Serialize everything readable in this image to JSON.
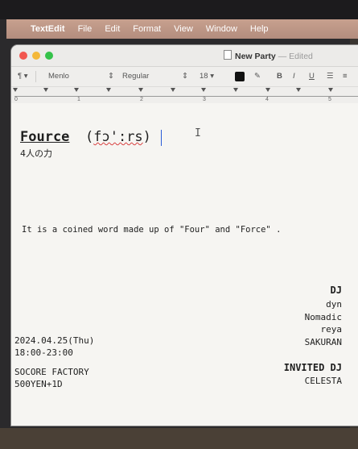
{
  "menubar": {
    "apple": "",
    "items": [
      "TextEdit",
      "File",
      "Edit",
      "Format",
      "View",
      "Window",
      "Help"
    ]
  },
  "window": {
    "title": "New Party",
    "status": "— Edited"
  },
  "toolbar": {
    "paragraph": "¶ ▾",
    "font": "Menlo",
    "style": "Regular",
    "size": "18 ▾",
    "bold": "B",
    "italic": "I",
    "underline": "U"
  },
  "ruler": {
    "numbers": [
      "0",
      "1",
      "2",
      "3",
      "4",
      "5"
    ]
  },
  "document": {
    "headword": "Fource",
    "pronunciation_open": "(",
    "pronunciation_word": "fɔ':rs",
    "pronunciation_close": ")",
    "subtitle": "4人の力",
    "description": "It is a coined word made up of \"Four\" and \"Force\" .",
    "dj_heading": "DJ",
    "djs": [
      "dyn",
      "Nomadic",
      "reya",
      "SAKURAN"
    ],
    "invited_heading": "INVITED DJ",
    "invited": [
      "CELESTA"
    ],
    "date": "2024.04.25(Thu)",
    "time": "18:00-23:00",
    "venue": "SOCORE FACTORY",
    "price": "500YEN+1D"
  },
  "colors": {
    "menubar": "#b8917f",
    "caret": "#2a5cd8",
    "spellcheck": "#d84040",
    "close": "#f2574f",
    "minimize": "#f4b83a",
    "maximize": "#35c24a"
  }
}
